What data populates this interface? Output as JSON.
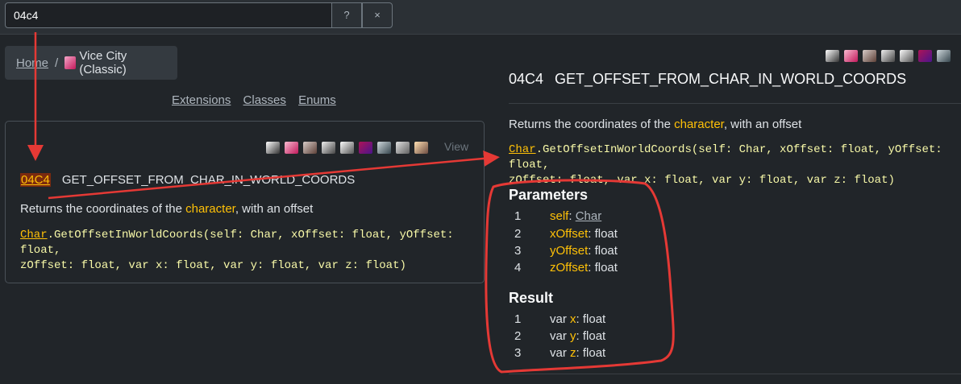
{
  "search": {
    "value": "04c4",
    "help_label": "?",
    "clear_label": "×"
  },
  "breadcrumb": {
    "home": "Home",
    "separator": "/",
    "game": "Vice City (Classic)"
  },
  "nav": {
    "links": [
      "Extensions",
      "Classes",
      "Enums"
    ]
  },
  "card": {
    "view_label": "View",
    "opcode": "04C4",
    "name": "GET_OFFSET_FROM_CHAR_IN_WORLD_COORDS",
    "desc_before": "Returns the coordinates of the ",
    "desc_link": "character",
    "desc_after": ", with an offset",
    "code_class": "Char",
    "code_rest_line1": ".GetOffsetInWorldCoords(self: Char, xOffset: float, yOffset: float,",
    "code_line2": "zOffset: float, var x: float, var y: float, var z: float)"
  },
  "detail": {
    "opcode": "04C4",
    "name": "GET_OFFSET_FROM_CHAR_IN_WORLD_COORDS",
    "desc_before": "Returns the coordinates of the ",
    "desc_link": "character",
    "desc_after": ", with an offset",
    "code_class": "Char",
    "code_rest_line1": ".GetOffsetInWorldCoords(self: Char, xOffset: float, yOffset: float,",
    "code_line2": "zOffset: float, var x: float, var y: float, var z: float)",
    "parameters_title": "Parameters",
    "parameters": [
      {
        "num": "1",
        "name": "self",
        "type": "Char"
      },
      {
        "num": "2",
        "name": "xOffset",
        "type": "float"
      },
      {
        "num": "3",
        "name": "yOffset",
        "type": "float"
      },
      {
        "num": "4",
        "name": "zOffset",
        "type": "float"
      }
    ],
    "result_title": "Result",
    "results": [
      {
        "num": "1",
        "prefix": "var ",
        "name": "x",
        "type": "float"
      },
      {
        "num": "2",
        "prefix": "var ",
        "name": "y",
        "type": "float"
      },
      {
        "num": "3",
        "prefix": "var ",
        "name": "z",
        "type": "float"
      }
    ]
  },
  "icons": {
    "game_icons": [
      "gta3-icon",
      "vc-icon",
      "sa-icon",
      "lcs-icon",
      "vcs-icon",
      "sa-mobile-icon",
      "gta4-icon",
      "gta-iv-icon",
      "unknown-icon"
    ]
  },
  "colors": {
    "accent": "#ffc107",
    "annotation": "#e53935",
    "background": "#212529"
  }
}
